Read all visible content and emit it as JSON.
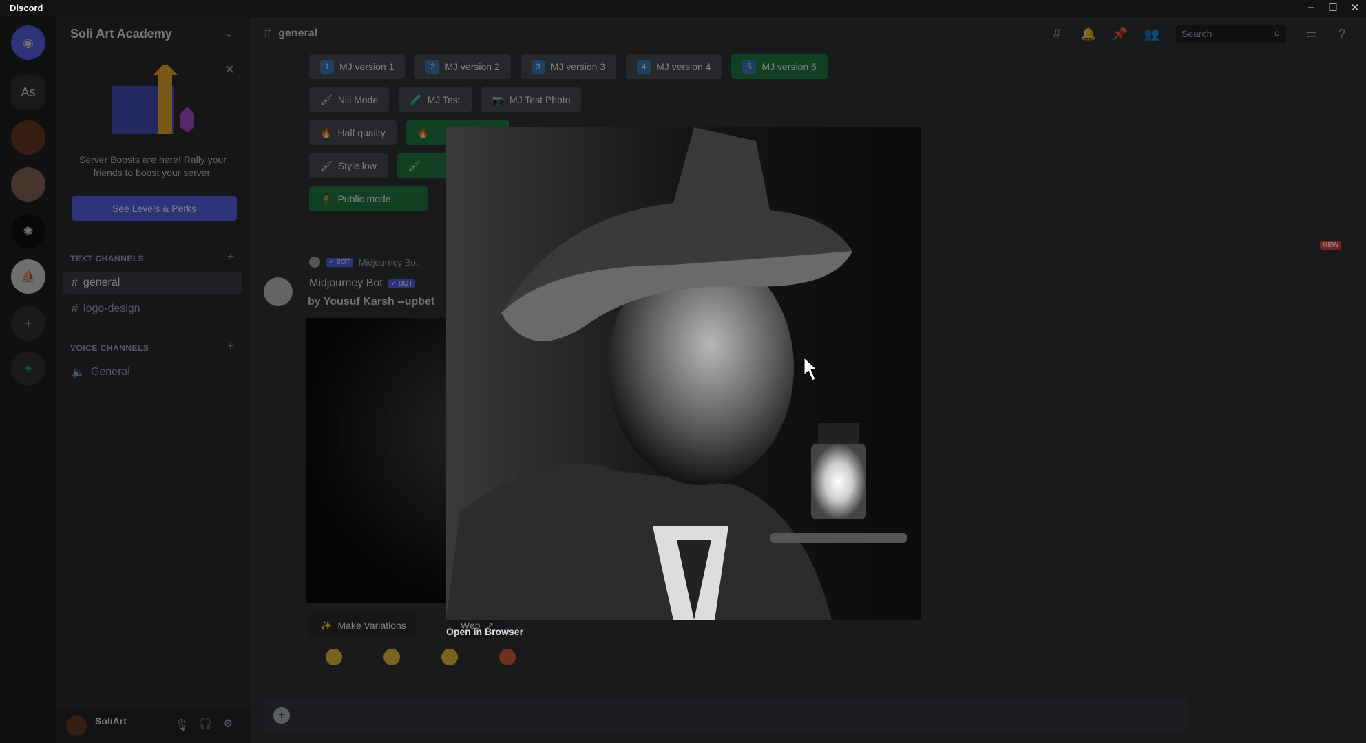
{
  "window": {
    "title": "Discord",
    "controls": [
      "minimize",
      "maximize",
      "close"
    ]
  },
  "server": {
    "name": "Soli Art Academy",
    "rail_initials": "As"
  },
  "boost": {
    "text": "Server Boosts are here! Rally your friends to boost your server.",
    "button": "See Levels & Perks"
  },
  "channels": {
    "text_header": "TEXT CHANNELS",
    "voice_header": "VOICE CHANNELS",
    "text": [
      "general",
      "logo-design"
    ],
    "voice": [
      "General"
    ]
  },
  "user": {
    "name": "SoliArt"
  },
  "header": {
    "channel": "general",
    "search_placeholder": "Search"
  },
  "buttons": {
    "versions": [
      {
        "n": "1",
        "label": "MJ version 1"
      },
      {
        "n": "2",
        "label": "MJ version 2"
      },
      {
        "n": "3",
        "label": "MJ version 3"
      },
      {
        "n": "4",
        "label": "MJ version 4"
      },
      {
        "n": "5",
        "label": "MJ version 5"
      }
    ],
    "row2": [
      "Niji Mode",
      "MJ Test",
      "MJ Test Photo"
    ],
    "row3": [
      "Half quality"
    ],
    "row4": [
      "Style low"
    ],
    "row5": [
      "Public mode"
    ]
  },
  "new_badge": "NEW",
  "message": {
    "author": "Midjourney Bot",
    "badge": "✓ BOT",
    "reply_author": "Midjourney Bot",
    "content": "by Yousuf Karsh --upbet",
    "variations": "Make Variations",
    "web": "Web"
  },
  "lightbox": {
    "open_in_browser": "Open in Browser"
  },
  "colors": {
    "blurple": "#5865f2",
    "green": "#248046",
    "bg": "#313338"
  }
}
